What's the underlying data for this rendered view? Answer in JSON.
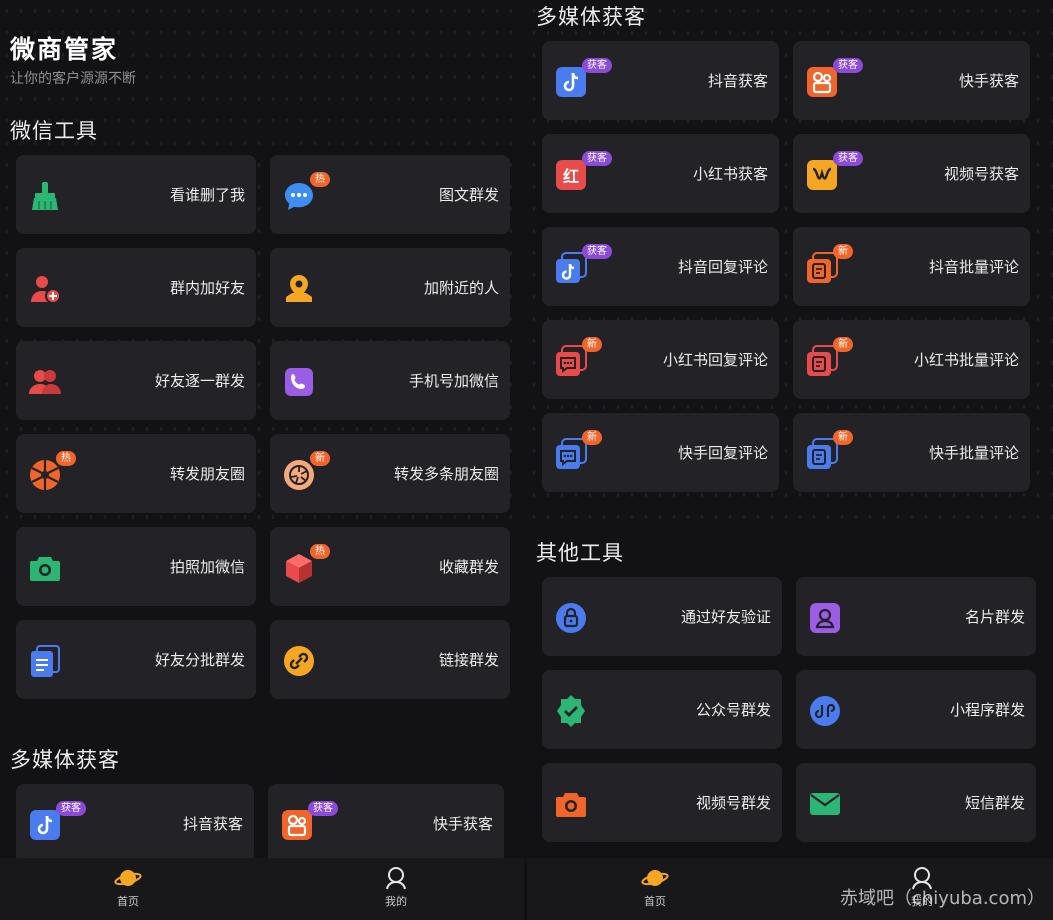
{
  "left": {
    "app_title": "微商管家",
    "app_subtitle": "让你的客户源源不断",
    "wechat_section": "微信工具",
    "wechat_tools": [
      {
        "label": "看谁删了我",
        "icon": "broom-icon",
        "badge": ""
      },
      {
        "label": "图文群发",
        "icon": "chat-bubble-icon",
        "badge": "热"
      },
      {
        "label": "群内加好友",
        "icon": "add-user-icon",
        "badge": ""
      },
      {
        "label": "加附近的人",
        "icon": "location-pin-icon",
        "badge": ""
      },
      {
        "label": "好友逐一群发",
        "icon": "users-icon",
        "badge": ""
      },
      {
        "label": "手机号加微信",
        "icon": "phone-icon",
        "badge": ""
      },
      {
        "label": "转发朋友圈",
        "icon": "aperture-icon",
        "badge": "热"
      },
      {
        "label": "转发多条朋友圈",
        "icon": "aperture-circle-icon",
        "badge": "新"
      },
      {
        "label": "拍照加微信",
        "icon": "camera-icon",
        "badge": ""
      },
      {
        "label": "收藏群发",
        "icon": "cube-icon",
        "badge": "热"
      },
      {
        "label": "好友分批群发",
        "icon": "document-stack-icon",
        "badge": ""
      },
      {
        "label": "链接群发",
        "icon": "link-icon",
        "badge": ""
      }
    ],
    "media_section": "多媒体获客",
    "media_preview": [
      {
        "label": "抖音获客",
        "icon": "douyin-icon",
        "badge": "获客"
      },
      {
        "label": "快手获客",
        "icon": "kuaishou-icon",
        "badge": "获客"
      }
    ]
  },
  "right": {
    "media_section": "多媒体获客",
    "media_tools": [
      {
        "label": "抖音获客",
        "icon": "douyin-icon",
        "badge": "获客"
      },
      {
        "label": "快手获客",
        "icon": "kuaishou-icon",
        "badge": "获客"
      },
      {
        "label": "小红书获客",
        "icon": "xiaohongshu-icon",
        "badge": "获客"
      },
      {
        "label": "视频号获客",
        "icon": "channels-icon",
        "badge": "获客"
      },
      {
        "label": "抖音回复评论",
        "icon": "douyin-reply-icon",
        "badge": "获客"
      },
      {
        "label": "抖音批量评论",
        "icon": "batch-comment-icon",
        "badge": "新"
      },
      {
        "label": "小红书回复评论",
        "icon": "reply-comment-icon",
        "badge": "新"
      },
      {
        "label": "小红书批量评论",
        "icon": "batch-comment-icon",
        "badge": "新"
      },
      {
        "label": "快手回复评论",
        "icon": "reply-comment-icon",
        "badge": "新"
      },
      {
        "label": "快手批量评论",
        "icon": "batch-comment-icon",
        "badge": "新"
      }
    ],
    "other_section": "其他工具",
    "other_tools": [
      {
        "label": "通过好友验证",
        "icon": "lock-icon"
      },
      {
        "label": "名片群发",
        "icon": "contact-card-icon"
      },
      {
        "label": "公众号群发",
        "icon": "verified-badge-icon"
      },
      {
        "label": "小程序群发",
        "icon": "mini-program-icon"
      },
      {
        "label": "视频号群发",
        "icon": "camera-icon"
      },
      {
        "label": "短信群发",
        "icon": "mail-icon"
      }
    ]
  },
  "tabbar": {
    "home": "首页",
    "mine": "我的"
  },
  "watermark": "赤域吧（chiyuba.com）",
  "colors": {
    "background": "#121215",
    "card": "#232327",
    "badge_purple": "#8b4bd8",
    "badge_orange": "#f1652a",
    "green": "#2bb673",
    "red": "#e94b4b",
    "orange": "#f5a623",
    "purple": "#9b5de5",
    "blue": "#4a7cf0"
  }
}
